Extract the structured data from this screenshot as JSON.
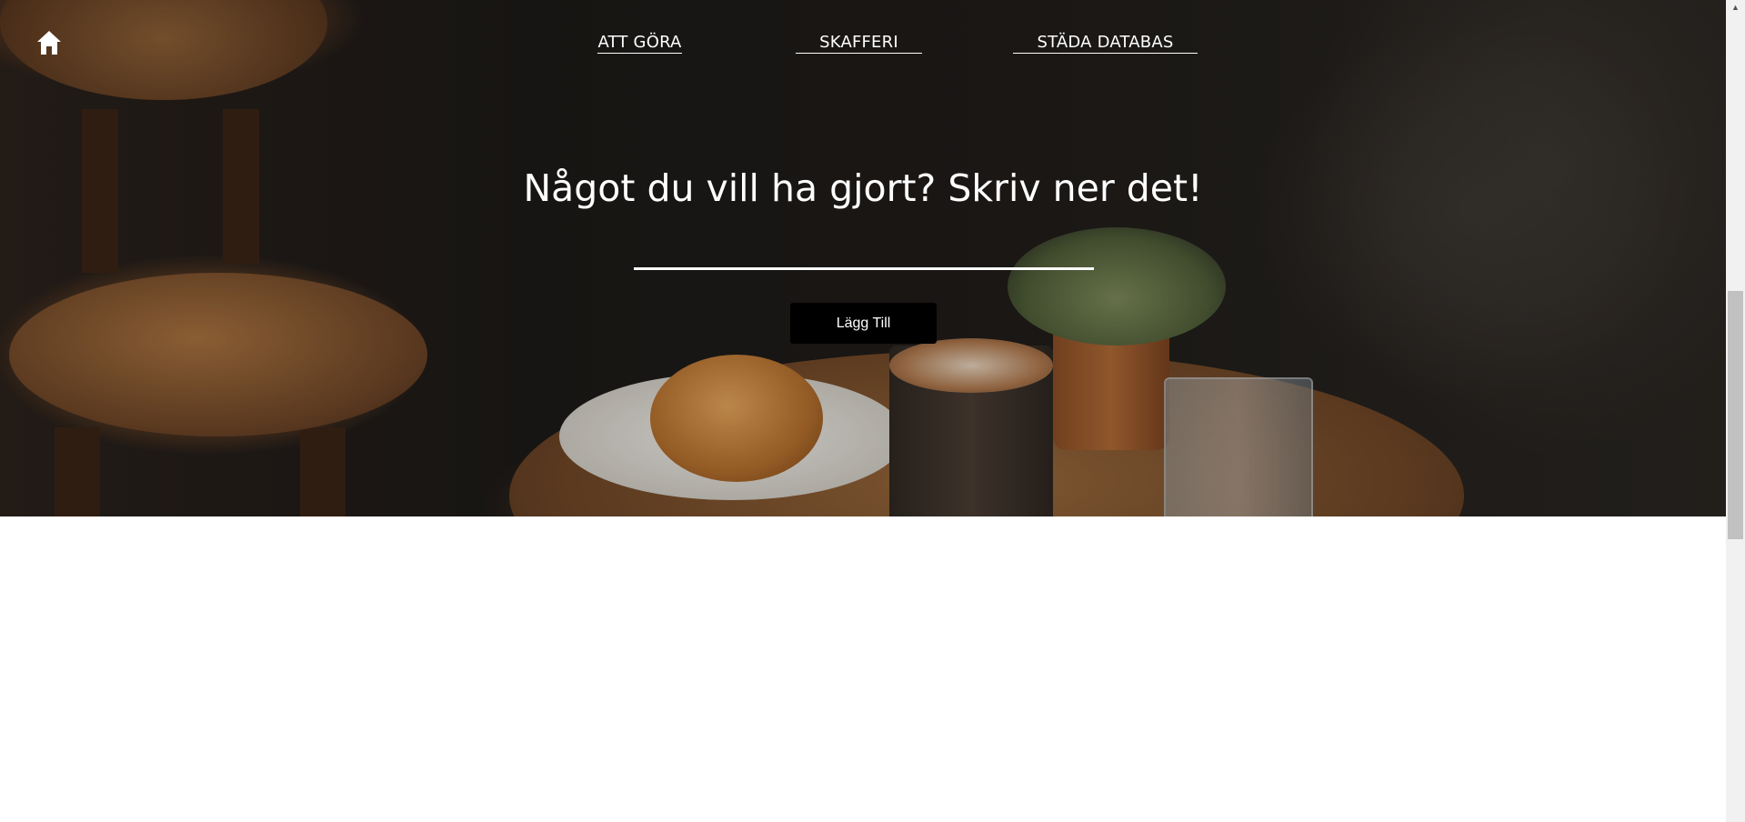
{
  "nav": {
    "home_icon": "home-icon",
    "links": [
      {
        "label": "ATT GÖRA"
      },
      {
        "label": "SKAFFERI"
      },
      {
        "label": "STÄDA DATABAS"
      }
    ]
  },
  "hero": {
    "headline": "Något du vill ha gjort? Skriv ner det!",
    "input_value": "",
    "button_label": "Lägg Till"
  },
  "colors": {
    "text": "#ffffff",
    "button_bg": "#000000",
    "page_bg": "#ffffff"
  }
}
